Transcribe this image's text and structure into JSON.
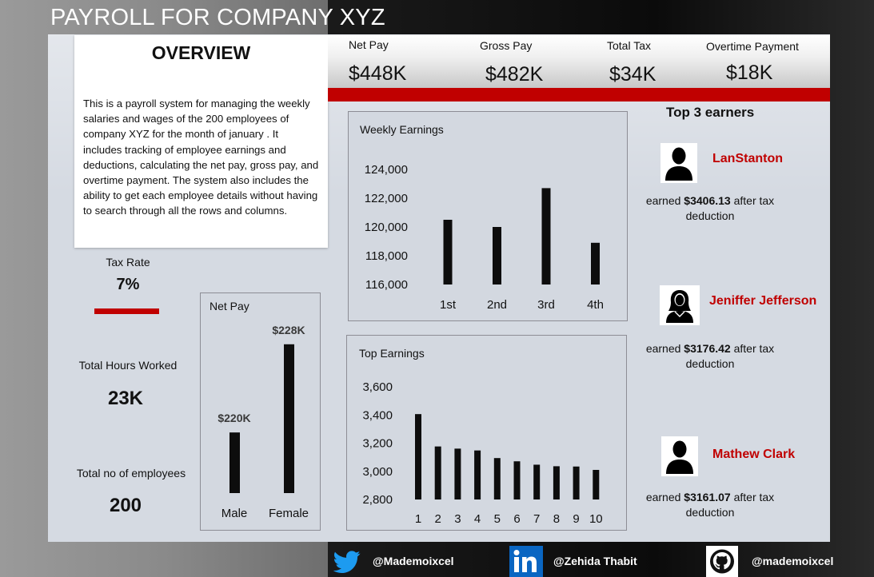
{
  "title": "PAYROLL FOR COMPANY XYZ",
  "overview": {
    "heading": "OVERVIEW",
    "text": "This is a payroll system for managing the weekly salaries and wages of the 200 employees of company XYZ for the month of january . It includes tracking of employee earnings and deductions, calculating the net pay, gross pay, and overtime payment. The system also includes the ability to get each employee details without having to search through all the rows and columns."
  },
  "kpis": {
    "net_pay": {
      "label": "Net Pay",
      "value": "$448K"
    },
    "gross_pay": {
      "label": "Gross Pay",
      "value": "$482K"
    },
    "total_tax": {
      "label": "Total Tax",
      "value": "$34K"
    },
    "overtime": {
      "label": "Overtime Payment",
      "value": "$18K"
    }
  },
  "side": {
    "tax_rate": {
      "label": "Tax Rate",
      "value": "7%"
    },
    "hours": {
      "label": "Total Hours Worked",
      "value": "23K"
    },
    "employees": {
      "label": "Total no of employees",
      "value": "200"
    }
  },
  "colors": {
    "accent": "#c00000",
    "bar": "#0d0d0d"
  },
  "chart_data": [
    {
      "type": "bar",
      "title": "Weekly Earnings",
      "categories": [
        "1st",
        "2nd",
        "3rd",
        "4th"
      ],
      "values": [
        120500,
        120000,
        122700,
        118900
      ],
      "ylim": [
        116000,
        124000
      ],
      "yticks": [
        116000,
        118000,
        120000,
        122000,
        124000
      ],
      "ytick_labels": [
        "116,000",
        "118,000",
        "120,000",
        "122,000",
        "124,000"
      ],
      "grid": false
    },
    {
      "type": "bar",
      "title": "Top Earnings",
      "categories": [
        "1",
        "2",
        "3",
        "4",
        "5",
        "6",
        "7",
        "8",
        "9",
        "10"
      ],
      "values": [
        3406.13,
        3176.42,
        3161.07,
        3148,
        3094,
        3071,
        3047,
        3036,
        3034,
        3010
      ],
      "ylim": [
        2800,
        3600
      ],
      "yticks": [
        2800,
        3000,
        3200,
        3400,
        3600
      ],
      "ytick_labels": [
        "2,800",
        "3,000",
        "3,200",
        "3,400",
        "3,600"
      ],
      "grid": false
    },
    {
      "type": "bar",
      "title": "Net Pay",
      "categories": [
        "Male",
        "Female"
      ],
      "values": [
        220,
        228
      ],
      "data_labels": [
        "$220K",
        "$228K"
      ],
      "value_unit": "thousands USD",
      "grid": false
    }
  ],
  "top_earners": {
    "title": "Top 3 earners",
    "earned_word": "earned",
    "after_tax": "after tax",
    "deduction": "deduction",
    "people": [
      {
        "name": "LanStanton",
        "amount": "$3406.13",
        "icon": "male-user-icon"
      },
      {
        "name": "Jeniffer Jefferson",
        "amount": "$3176.42",
        "icon": "female-user-icon"
      },
      {
        "name": "Mathew Clark",
        "amount": "$3161.07",
        "icon": "male-user-icon"
      }
    ]
  },
  "social": {
    "twitter": {
      "icon": "twitter-icon",
      "handle": "@Mademoixcel"
    },
    "linkedin": {
      "icon": "linkedin-icon",
      "handle": "@Zehida Thabit"
    },
    "github": {
      "icon": "github-icon",
      "handle": "@mademoixcel"
    }
  }
}
